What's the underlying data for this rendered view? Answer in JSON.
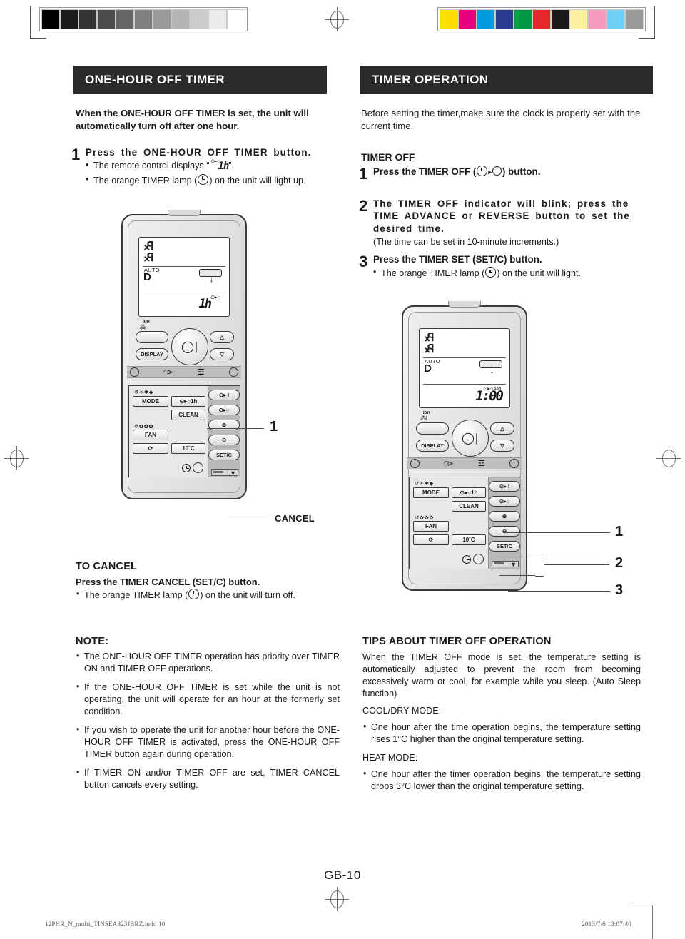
{
  "calibration": {
    "gray_swatches": [
      "#000000",
      "#1c1c1c",
      "#333333",
      "#4d4d4d",
      "#666666",
      "#808080",
      "#999999",
      "#b3b3b3",
      "#cccccc",
      "#ebebeb",
      "#ffffff"
    ],
    "color_swatches": [
      "#ffdd00",
      "#e6007e",
      "#0099dd",
      "#2b3a91",
      "#009944",
      "#e8272c",
      "#1a1a1a",
      "#faf0a0",
      "#f79ac0",
      "#6ecff6",
      "#9a9a9a"
    ]
  },
  "left_column": {
    "header": "ONE-HOUR OFF TIMER",
    "intro": "When the ONE-HOUR OFF TIMER is set, the unit will automatically turn off after one hour.",
    "step1": {
      "num": "1",
      "title": "Press the ONE-HOUR OFF TIMER button.",
      "bullet1_pre": "The remote control displays “",
      "bullet1_symbol_top": "⊙▸○",
      "bullet1_symbol": "1h",
      "bullet1_post": "”.",
      "bullet2_pre": "The orange TIMER lamp (",
      "bullet2_post": ") on the unit will light up."
    },
    "callout_1": "1",
    "callout_cancel": "CANCEL",
    "to_cancel": {
      "heading": "TO CANCEL",
      "lead": "Press the TIMER CANCEL (SET/C) button.",
      "bullet_pre": "The orange TIMER lamp (",
      "bullet_post": ") on the unit will turn off."
    },
    "note": {
      "heading": "NOTE:",
      "items": [
        "The ONE-HOUR OFF TIMER operation has priority over TIMER ON and TIMER OFF operations.",
        "If the ONE-HOUR OFF TIMER is set while the unit is not operating, the unit will operate for an hour at the formerly set condition.",
        "If you wish to operate the unit for another hour before the ONE-HOUR OFF TIMER is activated, press the ONE-HOUR OFF TIMER button again during operation.",
        "If TIMER ON and/or TIMER OFF are set, TIMER CANCEL button cancels every setting."
      ]
    }
  },
  "right_column": {
    "header": "TIMER OPERATION",
    "intro": "Before setting the timer,make sure the clock is properly set with the current time.",
    "subhead": "TIMER OFF ",
    "step1": {
      "num": "1",
      "title_pre": "Press the TIMER OFF (",
      "title_post": ") button."
    },
    "step2": {
      "num": "2",
      "title": "The TIMER OFF indicator will blink; press the TIME ADVANCE or REVERSE button to set the desired time.",
      "sub": "(The time can be set in 10-minute increments.)"
    },
    "step3": {
      "num": "3",
      "title": "Press the TIMER SET (SET/C) button.",
      "bullet_pre": "The orange TIMER lamp (",
      "bullet_post": ") on the unit will light."
    },
    "callouts": [
      "1",
      "2",
      "3"
    ],
    "tips": {
      "heading": "TIPS ABOUT TIMER OFF OPERATION",
      "intro": "When the TIMER OFF mode is set, the temperature setting is automatically adjusted to prevent the room from becoming excessively warm or cool, for example while you sleep. (Auto Sleep function)",
      "cool_head": "COOL/DRY MODE:",
      "cool_item": "One hour after the time operation begins, the temperature setting rises 1°C higher than the original temperature setting.",
      "heat_head": "HEAT MODE:",
      "heat_item": "One hour after the timer operation begins, the temperature setting drops 3°C lower than the original temperature setting."
    }
  },
  "remote_a": {
    "lcd": {
      "auto_label": "AUTO",
      "mode_letter": "D",
      "timer_tag": "⊙▸○",
      "value": "1h"
    },
    "buttons": {
      "ion_label": "Ion",
      "display": "DISPLAY",
      "mode": "MODE",
      "one_hour": "⊙▸○1h",
      "clean": "CLEAN",
      "fan": "FAN",
      "ten_c": "10˚C",
      "timer_on": "⊙▸ I",
      "timer_off": "⊙▸○",
      "plus": "⊕",
      "minus": "⊖",
      "set_c": "SET/C",
      "mode_icons": "↺☀✱◆",
      "fan_icons": "↺✿✿✿"
    }
  },
  "remote_b": {
    "lcd": {
      "auto_label": "AUTO",
      "mode_letter": "D",
      "timer_tag": "⊙▸○AM",
      "value": "1:00"
    },
    "buttons": {
      "ion_label": "Ion",
      "display": "DISPLAY",
      "mode": "MODE",
      "one_hour": "⊙▸○1h",
      "clean": "CLEAN",
      "fan": "FAN",
      "ten_c": "10˚C",
      "timer_on": "⊙▸ I",
      "timer_off": "⊙▸○",
      "plus": "⊕",
      "minus": "⊖",
      "set_c": "SET/C",
      "mode_icons": "↺☀✱◆",
      "fan_icons": "↺✿✿✿"
    }
  },
  "footer": {
    "page_number": "GB-10",
    "imprint_left": "12PHR_N_multi_TINSEA823JBRZ.indd   10",
    "imprint_right": "2013/7/6   13:07:40"
  }
}
